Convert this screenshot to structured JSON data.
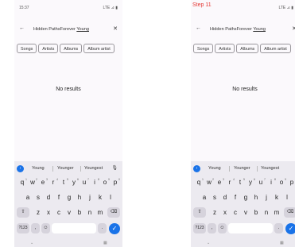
{
  "left": {
    "status": {
      "time": "15:37",
      "signal": "LTE ⊿ ▮"
    },
    "search": {
      "query_prefix": "Hidden PathsForever ",
      "query_underlined": "Young"
    },
    "chips": [
      "Songs",
      "Artists",
      "Albums",
      "Album artist"
    ],
    "no_results": "No results"
  },
  "right": {
    "step_label": "Step 11",
    "status": {
      "signal": "LTE ⊿ ▮"
    },
    "search": {
      "query_prefix": "Hidden PathsForever ",
      "query_underlined": "Young"
    },
    "chips": [
      "Songs",
      "Artists",
      "Albums",
      "Album artist"
    ],
    "no_results": "No results"
  },
  "keyboard": {
    "suggestions": [
      "Young",
      "Younger",
      "Youngest"
    ],
    "row1": [
      {
        "k": "q",
        "n": "1"
      },
      {
        "k": "w",
        "n": "2"
      },
      {
        "k": "e",
        "n": "3"
      },
      {
        "k": "r",
        "n": "4"
      },
      {
        "k": "t",
        "n": "5"
      },
      {
        "k": "y",
        "n": "6"
      },
      {
        "k": "u",
        "n": "7"
      },
      {
        "k": "i",
        "n": "8"
      },
      {
        "k": "o",
        "n": "9"
      },
      {
        "k": "p",
        "n": "0"
      }
    ],
    "row2": [
      "a",
      "s",
      "d",
      "f",
      "g",
      "h",
      "j",
      "k",
      "l"
    ],
    "row3": [
      "z",
      "x",
      "c",
      "v",
      "b",
      "n",
      "m"
    ],
    "symbols_label": "?123",
    "comma": ",",
    "period": "."
  },
  "icons": {
    "back": "arrow-left-icon",
    "clear": "close-icon",
    "mic": "microphone-icon",
    "shift": "shift-icon",
    "backspace": "backspace-icon",
    "enter": "checkmark-icon",
    "emoji": "emoji-icon"
  },
  "colors": {
    "accent": "#1a73e8",
    "step_label": "#e53935"
  }
}
